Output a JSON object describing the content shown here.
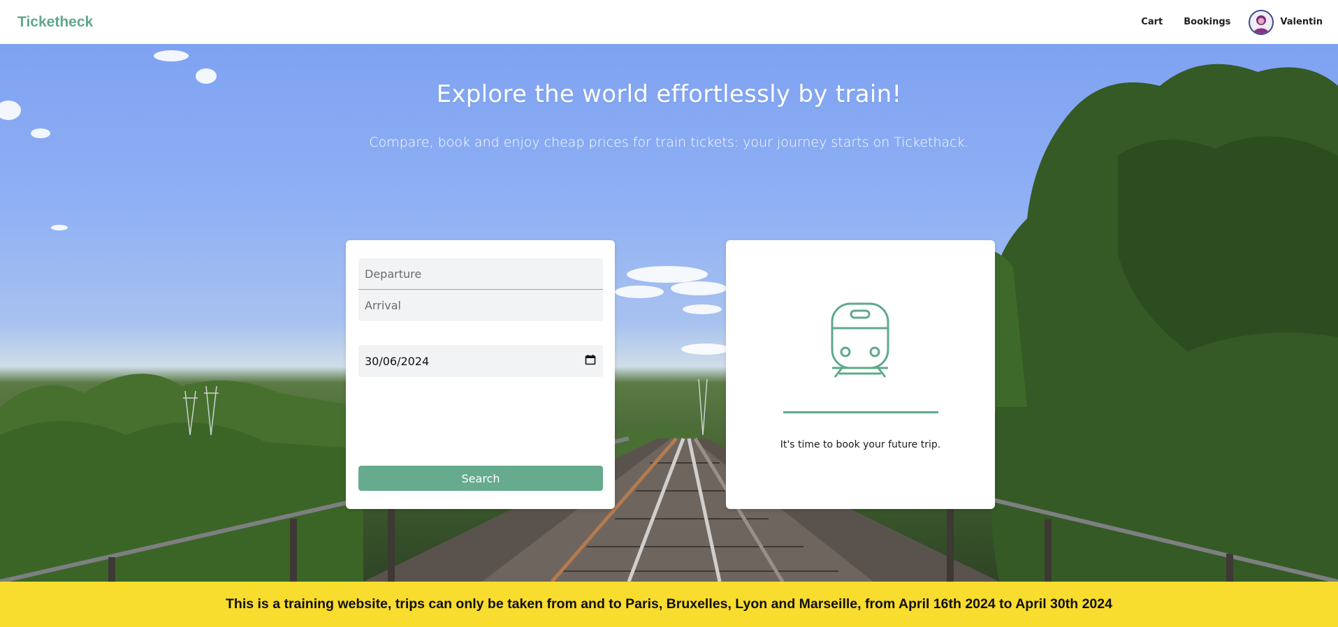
{
  "header": {
    "brand": "Ticketheck",
    "nav": {
      "cart": "Cart",
      "bookings": "Bookings"
    },
    "user": {
      "name": "Valentin",
      "avatar_icon": "user-avatar-icon"
    }
  },
  "hero": {
    "title": "Explore the world effortlessly by train!",
    "subtitle": "Compare, book and enjoy cheap prices for train tickets: your journey starts on Tickethack."
  },
  "search": {
    "departure_placeholder": "Departure",
    "arrival_placeholder": "Arrival",
    "date_value": "30/06/2024",
    "date_icon": "calendar-icon",
    "search_label": "Search"
  },
  "result": {
    "icon": "train-icon",
    "message": "It's time to book your future trip."
  },
  "banner": {
    "text": "This is a training website, trips can only be taken from and to Paris, Bruxelles, Lyon and Marseille, from April 16th 2024 to April 30th 2024"
  },
  "colors": {
    "brand": "#5fa98a",
    "button": "#67ab8e",
    "banner": "#f8dc2e"
  }
}
